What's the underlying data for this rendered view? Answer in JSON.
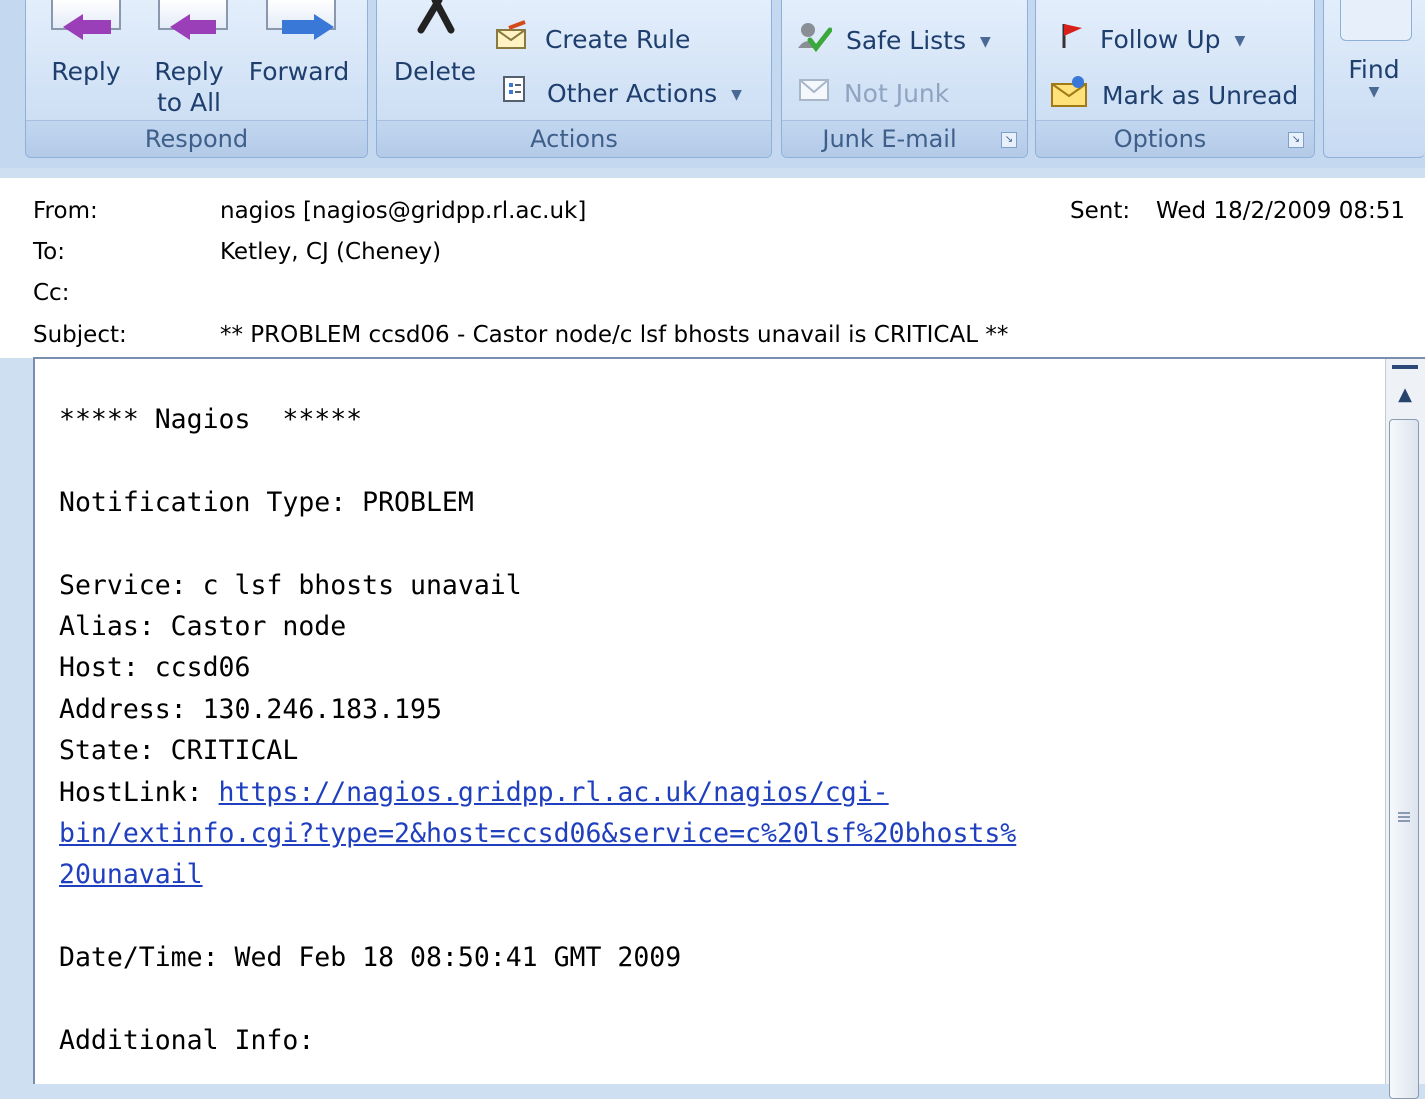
{
  "ribbon": {
    "respond": {
      "label": "Respond",
      "reply": "Reply",
      "reply_all_line1": "Reply",
      "reply_all_line2": "to All",
      "forward": "Forward"
    },
    "actions": {
      "label": "Actions",
      "delete": "Delete",
      "create_rule": "Create Rule",
      "other_actions": "Other Actions"
    },
    "junk": {
      "label": "Junk E-mail",
      "safe_lists": "Safe Lists",
      "not_junk": "Not Junk"
    },
    "options": {
      "label": "Options",
      "follow_up": "Follow Up",
      "mark_unread": "Mark as Unread"
    },
    "find": {
      "label": "Find"
    }
  },
  "header": {
    "from_label": "From:",
    "from_value": "nagios [nagios@gridpp.rl.ac.uk]",
    "sent_label": "Sent:",
    "sent_value": "Wed 18/2/2009 08:51",
    "to_label": "To:",
    "to_value": "Ketley, CJ (Cheney)",
    "cc_label": "Cc:",
    "cc_value": "",
    "subject_label": "Subject:",
    "subject_value": "** PROBLEM ccsd06 - Castor node/c lsf bhosts unavail is CRITICAL **"
  },
  "body": {
    "banner": "***** Nagios  *****",
    "notification_type": "Notification Type: PROBLEM",
    "service": "Service: c lsf bhosts unavail",
    "alias": "Alias: Castor node",
    "host": "Host: ccsd06",
    "address": "Address: 130.246.183.195",
    "state": "State: CRITICAL",
    "hostlink_label": "HostLink: ",
    "hostlink_url_line1": "https://nagios.gridpp.rl.ac.uk/nagios/cgi-",
    "hostlink_url_line2": "bin/extinfo.cgi?type=2&host=ccsd06&service=c%20lsf%20bhosts%",
    "hostlink_url_line3": "20unavail",
    "datetime": "Date/Time: Wed Feb 18 08:50:41 GMT 2009",
    "additional_info": "Additional Info:"
  },
  "colors": {
    "ribbon_bg": "#c4d8f0",
    "link": "#1f3fbf",
    "arrow_purple": "#9a3fb8",
    "arrow_blue": "#3a78d8"
  }
}
